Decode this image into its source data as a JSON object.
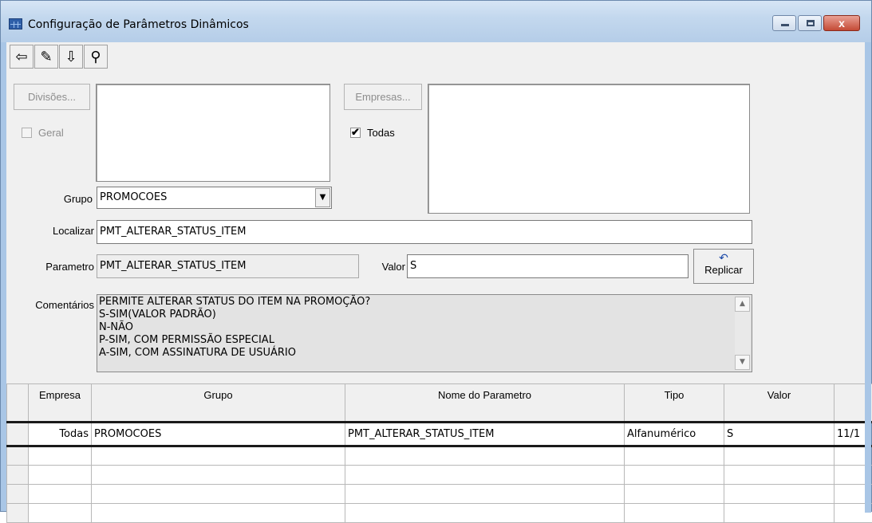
{
  "window": {
    "title": "Configuração de Parâmetros Dinâmicos",
    "controls": {
      "minimize": "minimize",
      "maximize": "maximize",
      "close": "x"
    }
  },
  "toolbar": {
    "buttons": [
      {
        "name": "exit-door-icon",
        "glyph": "⇦"
      },
      {
        "name": "eraser-icon",
        "glyph": "✎"
      },
      {
        "name": "save-tray-icon",
        "glyph": "⇩"
      },
      {
        "name": "binoculars-icon",
        "glyph": "⚲"
      }
    ]
  },
  "divisoes": {
    "button_label": "Divisões...",
    "geral_label": "Geral",
    "geral_checked": false
  },
  "empresas": {
    "button_label": "Empresas...",
    "todas_label": "Todas",
    "todas_checked": true
  },
  "grupo": {
    "label": "Grupo",
    "value": "PROMOCOES"
  },
  "localizar": {
    "label": "Localizar",
    "value": "PMT_ALTERAR_STATUS_ITEM"
  },
  "parametro": {
    "label": "Parametro",
    "value": "PMT_ALTERAR_STATUS_ITEM"
  },
  "valor": {
    "label": "Valor",
    "value": "S"
  },
  "replicar": {
    "label": "Replicar"
  },
  "comentarios": {
    "label": "Comentários",
    "lines": [
      "PERMITE ALTERAR STATUS DO ITEM NA PROMOÇÃO?",
      "S-SIM(VALOR PADRÃO)",
      "N-NÃO",
      "P-SIM, COM PERMISSÃO ESPECIAL",
      "A-SIM, COM ASSINATURA DE USUÁRIO"
    ]
  },
  "grid": {
    "columns": [
      "Empresa",
      "Grupo",
      "Nome do Parametro",
      "Tipo",
      "Valor",
      ""
    ],
    "rows": [
      {
        "empresa": "Todas",
        "grupo": "PROMOCOES",
        "nome": "PMT_ALTERAR_STATUS_ITEM",
        "tipo": "Alfanumérico",
        "valor": "S",
        "extra": "11/1"
      }
    ]
  }
}
